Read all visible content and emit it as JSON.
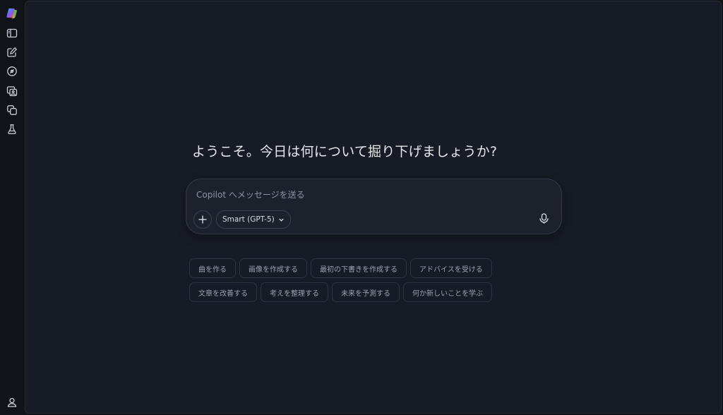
{
  "sidebar": {
    "items": [
      {
        "icon": "copilot-logo-icon"
      },
      {
        "icon": "sidebar-toggle-icon"
      },
      {
        "icon": "new-chat-icon"
      },
      {
        "icon": "discover-icon"
      },
      {
        "icon": "create-image-icon"
      },
      {
        "icon": "library-icon"
      },
      {
        "icon": "labs-icon"
      }
    ],
    "footer_icon": "profile-icon"
  },
  "main": {
    "greeting": "ようこそ。今日は何について掘り下げましょうか?"
  },
  "composer": {
    "placeholder": "Copilot へメッセージを送る",
    "value": "",
    "model_label": "Smart (GPT-5)"
  },
  "suggestions": {
    "row1": [
      "曲を作る",
      "画像を作成する",
      "最初の下書きを作成する",
      "アドバイスを受ける"
    ],
    "row2": [
      "文章を改善する",
      "考えを整理する",
      "未来を予測する",
      "何か新しいことを学ぶ"
    ]
  },
  "colors": {
    "background": "#101317",
    "panel": "#171b25",
    "composer": "#1c212c",
    "border": "#343b4a",
    "text": "#e6e8ec",
    "muted_text": "#9aa1ae"
  }
}
